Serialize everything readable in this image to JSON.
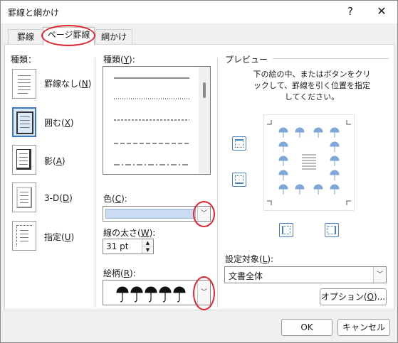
{
  "window": {
    "title": "罫線と網かけ",
    "help": "?",
    "close": "✕"
  },
  "tabs": [
    {
      "label": "罫線"
    },
    {
      "label": "ページ罫線"
    },
    {
      "label": "網かけ"
    }
  ],
  "settings": {
    "label": "種類：",
    "items": [
      {
        "text": "罫線なし(",
        "key": "N",
        "end": ")"
      },
      {
        "text": "囲む(",
        "key": "X",
        "end": ")"
      },
      {
        "text": "影(",
        "key": "A",
        "end": ")"
      },
      {
        "text": "3-D(",
        "key": "D",
        "end": ")"
      },
      {
        "text": "指定(",
        "key": "U",
        "end": ")"
      }
    ]
  },
  "style": {
    "label": "種類(",
    "key": "Y",
    "end": "):",
    "color_label": "色(",
    "color_key": "C",
    "color_end": "):",
    "color_value": "#c9dcf2",
    "width_label": "線の太さ(",
    "width_key": "W",
    "width_end": "):",
    "width_value": "31 pt",
    "art_label": "絵柄(",
    "art_key": "R",
    "art_end": "):",
    "art_glyph": "umbrella"
  },
  "preview": {
    "label": "プレビュー",
    "instruction": "下の絵の中、またはボタンをクリックして、罫線を引く位置を指定してください。",
    "apply_label": "設定対象(",
    "apply_key": "L",
    "apply_end": "):",
    "apply_value": "文書全体",
    "options_label": "オプション(",
    "options_key": "O",
    "options_end": ")..."
  },
  "buttons": {
    "ok": "OK",
    "cancel": "キャンセル"
  },
  "colors": {
    "accent": "#3b78c4",
    "highlight": "#e3232d",
    "art": "#7fa6d6"
  }
}
